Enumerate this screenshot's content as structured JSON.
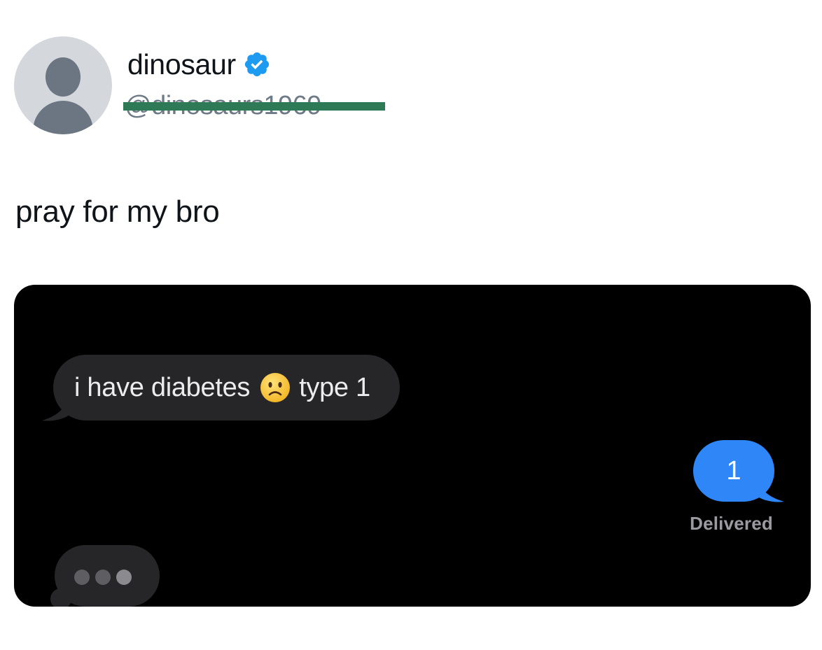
{
  "post": {
    "display_name": "dinosaur",
    "handle": "@dinosaurs1969",
    "text": "pray for my bro",
    "icons": {
      "avatar": "default-profile-avatar",
      "verified": "verified-badge-icon"
    }
  },
  "chat": {
    "incoming_message": {
      "text_before_emoji": "i have diabetes",
      "emoji": "slightly-frowning-face",
      "text_after_emoji": "type 1"
    },
    "outgoing_message": {
      "text": "1",
      "status": "Delivered"
    },
    "typing_indicator": {
      "icon": "typing-dots-icon"
    }
  },
  "colors": {
    "verified_blue": "#1d9bf0",
    "redaction_green": "#2f7a56",
    "outgoing_bubble": "#2f86f6",
    "incoming_bubble": "#262628",
    "chat_background": "#000000"
  }
}
